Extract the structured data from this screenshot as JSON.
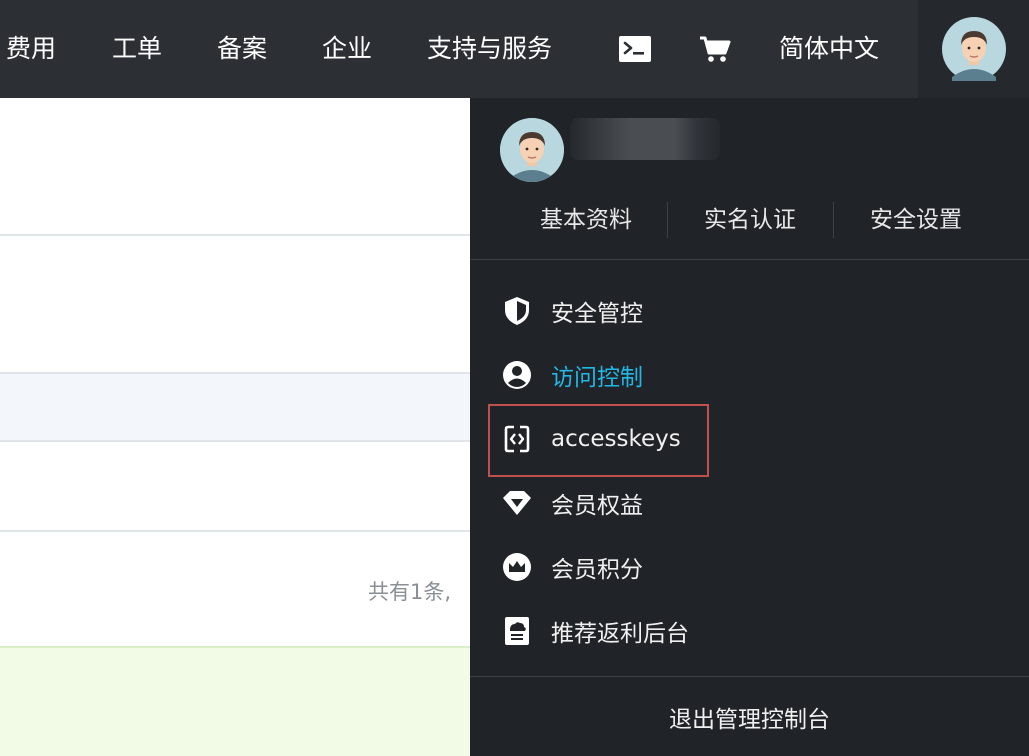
{
  "topnav": {
    "items": [
      "费用",
      "工单",
      "备案",
      "企业",
      "支持与服务"
    ],
    "terminal_icon": "terminal-icon",
    "cart_icon": "cart-icon",
    "language": "简体中文",
    "avatar_icon": "user-avatar"
  },
  "page": {
    "total_text": "共有1条,"
  },
  "dropdown": {
    "profile_links": [
      "基本资料",
      "实名认证",
      "安全设置"
    ],
    "menu": [
      {
        "label": "安全管控",
        "icon": "shield-icon"
      },
      {
        "label": "访问控制",
        "icon": "user-circle-icon",
        "active": true
      },
      {
        "label": "accesskeys",
        "icon": "code-brackets-icon",
        "highlighted": true
      },
      {
        "label": "会员权益",
        "icon": "diamond-icon"
      },
      {
        "label": "会员积分",
        "icon": "crown-icon"
      },
      {
        "label": "推荐返利后台",
        "icon": "referral-icon"
      }
    ],
    "logout": "退出管理控制台"
  },
  "colors": {
    "topbar_bg": "#2c3035",
    "dropdown_bg": "#202327",
    "active_link": "#23b7e5",
    "highlight_border": "#c0504d"
  }
}
